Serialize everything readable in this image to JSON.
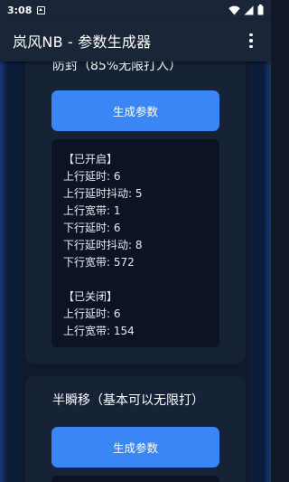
{
  "status_bar": {
    "time": "3:08"
  },
  "app_bar": {
    "title": "岚风NB - 参数生成器"
  },
  "sections": [
    {
      "title": "防封（85%无限打人）",
      "button_label": "生成参数",
      "result_lines": [
        "【已开启】",
        "上行延时: 6",
        "上行延时抖动: 5",
        "上行宽带: 1",
        "下行延时: 6",
        "下行延时抖动: 8",
        "下行宽带: 572",
        "",
        "【已关闭】",
        "上行延时: 6",
        "上行宽带: 154"
      ]
    },
    {
      "title": "半瞬移（基本可以无限打）",
      "button_label": "生成参数"
    }
  ],
  "colors": {
    "accent": "#3a86f5",
    "panel": "#162235",
    "result_bg": "#0c1423",
    "app_bar": "#1a2537"
  },
  "icons": {
    "notification": "notification-icon",
    "wifi": "wifi-icon",
    "signal": "signal-icon",
    "battery": "battery-icon",
    "menu": "overflow-menu-icon"
  }
}
